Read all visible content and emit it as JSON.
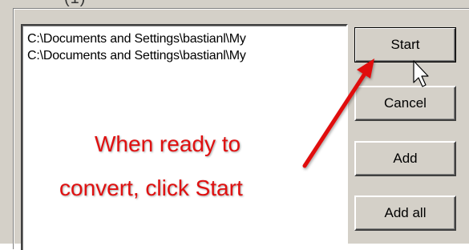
{
  "top_strip_text": "(1)",
  "file_list": {
    "items": [
      "C:\\Documents and Settings\\bastianl\\My",
      "C:\\Documents and Settings\\bastianl\\My"
    ]
  },
  "buttons": {
    "start": "Start",
    "cancel": "Cancel",
    "add": "Add",
    "add_all": "Add all"
  },
  "annotation": {
    "line1": "When ready to",
    "line2": "convert, click Start",
    "color": "#e01010"
  }
}
